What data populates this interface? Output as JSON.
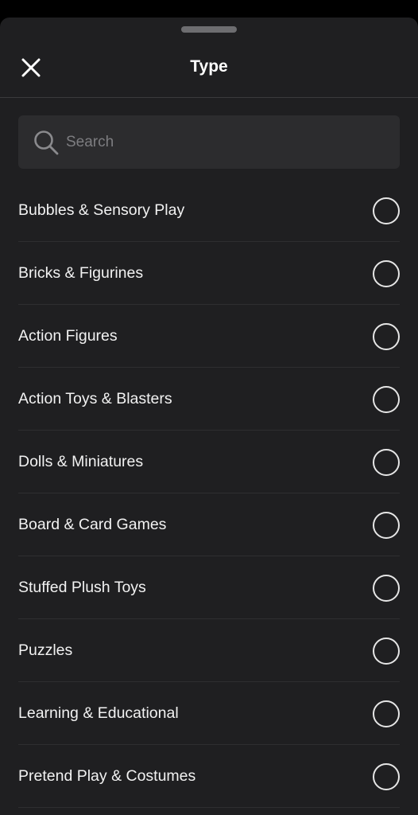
{
  "header": {
    "title": "Type",
    "close_icon": "close-icon"
  },
  "search": {
    "placeholder": "Search",
    "value": "",
    "icon": "search-icon"
  },
  "options": [
    {
      "label": "Bubbles & Sensory Play",
      "selected": false
    },
    {
      "label": "Bricks & Figurines",
      "selected": false
    },
    {
      "label": "Action Figures",
      "selected": false
    },
    {
      "label": "Action Toys & Blasters",
      "selected": false
    },
    {
      "label": "Dolls & Miniatures",
      "selected": false
    },
    {
      "label": "Board & Card Games",
      "selected": false
    },
    {
      "label": "Stuffed Plush Toys",
      "selected": false
    },
    {
      "label": "Puzzles",
      "selected": false
    },
    {
      "label": "Learning & Educational",
      "selected": false
    },
    {
      "label": "Pretend Play & Costumes",
      "selected": false
    }
  ],
  "colors": {
    "background": "#1f1f21",
    "search_background": "#2c2c2e",
    "text": "#f2f2f2",
    "placeholder": "#7d7d80"
  }
}
